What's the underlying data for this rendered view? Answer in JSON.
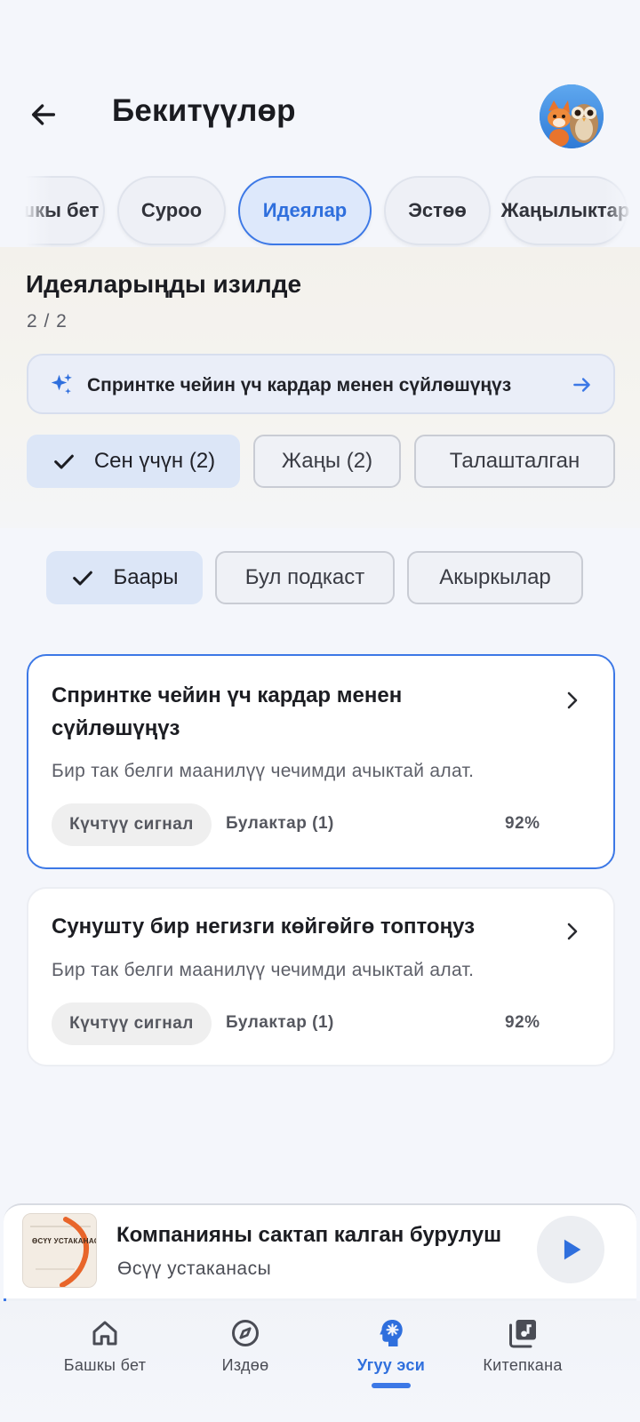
{
  "header": {
    "title": "Бекитүүлөр",
    "back_icon": "arrow-left-icon",
    "avatar_icon": "avatar-fox-owl"
  },
  "tabs": [
    {
      "label": "Башкы бет",
      "active": false
    },
    {
      "label": "Суроо",
      "active": false
    },
    {
      "label": "Идеялар",
      "active": true
    },
    {
      "label": "Эстөө",
      "active": false
    },
    {
      "label": "Жаңылыктар",
      "active": false
    }
  ],
  "ideas": {
    "title": "Идеяларыңды изилде",
    "page_count": "2 / 2",
    "banner_text": "Спринтке чейин үч кардар менен сүйлөшүңүз"
  },
  "filters_primary": [
    {
      "label": "Сен үчүн (2)",
      "selected": true
    },
    {
      "label": "Жаңы (2)",
      "selected": false
    },
    {
      "label": "Талашталган",
      "selected": false
    }
  ],
  "filters_secondary": [
    {
      "label": "Баары",
      "selected": true
    },
    {
      "label": "Бул подкаст",
      "selected": false
    },
    {
      "label": "Акыркылар",
      "selected": false
    }
  ],
  "cards": [
    {
      "title": "Спринтке чейин үч кардар менен сүйлөшүңүз",
      "description": "Бир так белги маанилүү чечимди ачыктай алат.",
      "signal": "Күчтүү сигнал",
      "sources": "Булактар (1)",
      "score": "92%",
      "highlighted": true
    },
    {
      "title": "Сунушту бир негизги көйгөйгө топтоңуз",
      "description": "Бир так белги маанилүү чечимди ачыктай алат.",
      "signal": "Күчтүү сигнал",
      "sources": "Булактар (1)",
      "score": "92%",
      "highlighted": false
    }
  ],
  "player": {
    "title": "Компанияны сактап калган бурулуш",
    "subtitle": "Өсүү устаканасы",
    "cover_text": "ӨСҮҮ УСТАКАНАСЫ",
    "progress": 0.004
  },
  "nav": [
    {
      "label": "Башкы бет",
      "icon": "home-icon",
      "active": false
    },
    {
      "label": "Издөө",
      "icon": "compass-icon",
      "active": false
    },
    {
      "label": "Угуу эси",
      "icon": "brain-gear-icon",
      "active": true
    },
    {
      "label": "Китепкана",
      "icon": "library-music-icon",
      "active": false
    }
  ],
  "colors": {
    "accent": "#3c78e6",
    "background": "#f4f6fb",
    "card": "#ffffff"
  }
}
